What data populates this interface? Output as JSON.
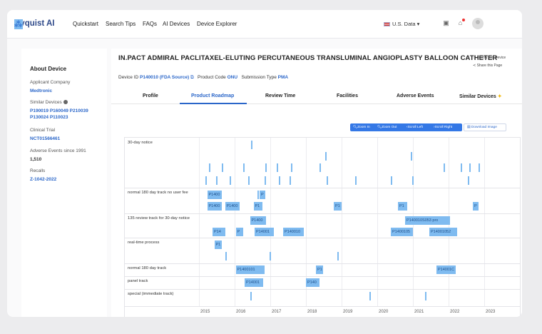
{
  "nav": {
    "logo": "Nyquist AI",
    "items": [
      "Quickstart",
      "Search Tips",
      "FAQs",
      "AI Devices",
      "Device Explorer"
    ],
    "region": "U.S. Data"
  },
  "sidebar": {
    "heading": "About Device",
    "applicant_label": "Applicant Company",
    "applicant": "Medtronic",
    "similar_label": "Similar Devices",
    "similar_line1": "P190019 P160049 P210039",
    "similar_line2": "P130024 P110023",
    "trial_label": "Clinical Trial",
    "trial": "NCT01566461",
    "ae_label": "Adverse Events since 1991",
    "ae_count": "1,510",
    "recalls_label": "Recalls",
    "recall": "Z-1042-2022"
  },
  "device": {
    "title": "IN.PACT ADMIRAL PACLITAXEL-ELUTING PERCUTANEOUS TRANSLUMINAL ANGIOPLASTY BALLOON CATHETER",
    "follow": "Follow this Device",
    "share": "Share this Page",
    "id_label": "Device ID",
    "id_value": "P140010 (FDA Source)",
    "code_label": "Product Code",
    "code_value": "ONU",
    "sub_label": "Submission Type",
    "sub_value": "PMA"
  },
  "tabs": [
    "Profile",
    "Product Roadmap",
    "Review Time",
    "Facilities",
    "Adverse Events",
    "Similar Devices"
  ],
  "toolbar": {
    "zoom_in": "Zoom In",
    "zoom_out": "Zoom Out",
    "scroll_left": "Scroll Left",
    "scroll_right": "Scroll Right",
    "download": "Download Image"
  },
  "roadmap": {
    "tracks": [
      "30-day notice",
      "normal 180 day track no user fee",
      "135 review track for 30-day notice",
      "real-time process",
      "normal 180 day track",
      "panel track",
      "special (immediate track)"
    ],
    "years": [
      "2015",
      "2016",
      "2017",
      "2018",
      "2019",
      "2020",
      "2021",
      "2022",
      "2023"
    ],
    "bars": [
      {
        "track": 1,
        "lane": 0,
        "start": 2015.15,
        "end": 2015.55,
        "label": "P1400"
      },
      {
        "track": 1,
        "lane": 0,
        "start": 2016.62,
        "end": 2016.78,
        "label": "P"
      },
      {
        "track": 1,
        "lane": 1,
        "start": 2015.15,
        "end": 2015.55,
        "label": "P1400"
      },
      {
        "track": 1,
        "lane": 1,
        "start": 2015.65,
        "end": 2016.05,
        "label": "P1400"
      },
      {
        "track": 1,
        "lane": 1,
        "start": 2016.45,
        "end": 2016.7,
        "label": "P1"
      },
      {
        "track": 1,
        "lane": 1,
        "start": 2018.7,
        "end": 2018.92,
        "label": "P1"
      },
      {
        "track": 1,
        "lane": 1,
        "start": 2020.5,
        "end": 2020.75,
        "label": "P1"
      },
      {
        "track": 1,
        "lane": 1,
        "start": 2022.6,
        "end": 2022.75,
        "label": "P"
      },
      {
        "track": 2,
        "lane": 0,
        "start": 2016.35,
        "end": 2016.8,
        "label": "P1400"
      },
      {
        "track": 2,
        "lane": 0,
        "start": 2020.7,
        "end": 2021.95,
        "label": "P140010S053 pro"
      },
      {
        "track": 2,
        "lane": 1,
        "start": 2015.3,
        "end": 2015.65,
        "label": "P14"
      },
      {
        "track": 2,
        "lane": 1,
        "start": 2015.95,
        "end": 2016.15,
        "label": "P"
      },
      {
        "track": 2,
        "lane": 1,
        "start": 2016.48,
        "end": 2017.02,
        "label": "P14001"
      },
      {
        "track": 2,
        "lane": 1,
        "start": 2017.28,
        "end": 2017.85,
        "label": "P140010"
      },
      {
        "track": 2,
        "lane": 1,
        "start": 2020.3,
        "end": 2020.92,
        "label": "P1400105"
      },
      {
        "track": 2,
        "lane": 1,
        "start": 2021.38,
        "end": 2022.15,
        "label": "P14001052"
      },
      {
        "track": 3,
        "lane": 0,
        "start": 2015.35,
        "end": 2015.55,
        "label": "P1"
      },
      {
        "track": 4,
        "lane": 0,
        "start": 2015.95,
        "end": 2016.75,
        "label": "P1400101"
      },
      {
        "track": 4,
        "lane": 0,
        "start": 2018.2,
        "end": 2018.4,
        "label": "P1"
      },
      {
        "track": 4,
        "lane": 0,
        "start": 2021.58,
        "end": 2022.12,
        "label": "P14001C"
      },
      {
        "track": 5,
        "lane": 0,
        "start": 2016.2,
        "end": 2016.72,
        "label": "P14001"
      },
      {
        "track": 5,
        "lane": 0,
        "start": 2017.92,
        "end": 2018.3,
        "label": "P140"
      }
    ],
    "ticks": [
      {
        "track": 0,
        "lane": 0,
        "x": 2016.38
      },
      {
        "track": 0,
        "lane": 1,
        "x": 2018.45
      },
      {
        "track": 0,
        "lane": 1,
        "x": 2020.85
      },
      {
        "track": 0,
        "lane": 2,
        "x": 2015.2
      },
      {
        "track": 0,
        "lane": 2,
        "x": 2015.55
      },
      {
        "track": 0,
        "lane": 2,
        "x": 2016.15
      },
      {
        "track": 0,
        "lane": 2,
        "x": 2016.78
      },
      {
        "track": 0,
        "lane": 2,
        "x": 2017.1
      },
      {
        "track": 0,
        "lane": 2,
        "x": 2017.5
      },
      {
        "track": 0,
        "lane": 2,
        "x": 2018.3
      },
      {
        "track": 0,
        "lane": 2,
        "x": 2021.78
      },
      {
        "track": 0,
        "lane": 2,
        "x": 2022.25
      },
      {
        "track": 0,
        "lane": 2,
        "x": 2022.5
      },
      {
        "track": 0,
        "lane": 2,
        "x": 2022.75
      },
      {
        "track": 0,
        "lane": 3,
        "x": 2015.1
      },
      {
        "track": 0,
        "lane": 3,
        "x": 2015.4
      },
      {
        "track": 0,
        "lane": 3,
        "x": 2015.78
      },
      {
        "track": 0,
        "lane": 3,
        "x": 2016.3
      },
      {
        "track": 0,
        "lane": 3,
        "x": 2016.75
      },
      {
        "track": 0,
        "lane": 3,
        "x": 2017.15
      },
      {
        "track": 0,
        "lane": 3,
        "x": 2017.45
      },
      {
        "track": 0,
        "lane": 3,
        "x": 2018.5
      },
      {
        "track": 0,
        "lane": 3,
        "x": 2019.3
      },
      {
        "track": 0,
        "lane": 3,
        "x": 2020.3
      },
      {
        "track": 0,
        "lane": 3,
        "x": 2020.9
      },
      {
        "track": 0,
        "lane": 3,
        "x": 2022.45
      },
      {
        "track": 1,
        "lane": 0,
        "x": 2016.55
      },
      {
        "track": 3,
        "lane": 1,
        "x": 2015.65
      },
      {
        "track": 3,
        "lane": 1,
        "x": 2016.9
      },
      {
        "track": 3,
        "lane": 1,
        "x": 2018.8
      },
      {
        "track": 6,
        "lane": 0,
        "x": 2016.35
      },
      {
        "track": 6,
        "lane": 0,
        "x": 2019.7
      },
      {
        "track": 6,
        "lane": 0,
        "x": 2021.25
      }
    ]
  }
}
